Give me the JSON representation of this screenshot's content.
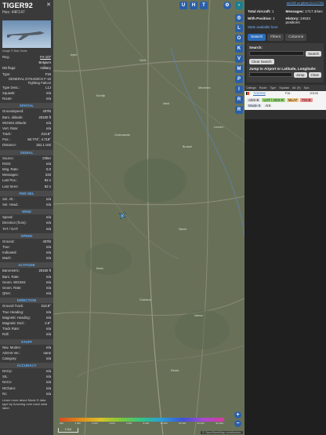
{
  "left": {
    "callsign": "TIGER92",
    "hex": "Hex: 44F147",
    "close": "✕",
    "image_caption": "Image © Bdw Smits",
    "basic": [
      {
        "k": "Reg.:",
        "v": "FA-107",
        "link": true
      },
      {
        "k": "",
        "v": "Belgium"
      },
      {
        "k": "DB flags:",
        "v": "military"
      },
      {
        "k": "Type:",
        "v": "F16"
      },
      {
        "k": "GENERAL DYNAMICS F-16 Fighting Falcon",
        "v": ""
      },
      {
        "k": "Type Desc.:",
        "v": "L1J"
      },
      {
        "k": "Squawk:",
        "v": "n/a"
      },
      {
        "k": "Route:",
        "v": "n/a"
      }
    ],
    "sections": [
      {
        "title": "SPATIAL",
        "rows": [
          {
            "k": "Groundspeed:",
            "v": "437kt"
          },
          {
            "k": "Baro. altitude:",
            "v": "20100 ft"
          },
          {
            "k": "WGS84 altitude:",
            "v": "n/a"
          },
          {
            "k": "Vert. Rate:",
            "v": "n/a"
          },
          {
            "k": "Track:",
            "v": "213.8°"
          },
          {
            "k": "Pos.:",
            "v": "50.774°, 4.718°"
          },
          {
            "k": "Distance:",
            "v": "151.1 nmi"
          }
        ]
      },
      {
        "title": "SIGNAL",
        "rows": [
          {
            "k": "Source:",
            "v": "Other"
          },
          {
            "k": "RSSI:",
            "v": "n/a"
          },
          {
            "k": "Msg. Rate:",
            "v": "0.0"
          },
          {
            "k": "Messages:",
            "v": "233"
          },
          {
            "k": "Last Pos.:",
            "v": "92 s"
          },
          {
            "k": "Last Seen:",
            "v": "62 s"
          }
        ]
      },
      {
        "title": "FMS SEL",
        "rows": [
          {
            "k": "Sel. Alt.:",
            "v": "n/a"
          },
          {
            "k": "Sel. Head.:",
            "v": "n/a"
          }
        ]
      },
      {
        "title": "WIND",
        "rows": [
          {
            "k": "Speed:",
            "v": "n/a"
          },
          {
            "k": "Direction (from):",
            "v": "n/a"
          },
          {
            "k": "TAT / OAT:",
            "v": "n/a"
          }
        ]
      },
      {
        "title": "SPEED",
        "rows": [
          {
            "k": "Ground:",
            "v": "437kt"
          },
          {
            "k": "True:",
            "v": "n/a"
          },
          {
            "k": "Indicated:",
            "v": "n/a"
          },
          {
            "k": "Mach:",
            "v": "n/a"
          }
        ]
      },
      {
        "title": "ALTITUDE",
        "rows": [
          {
            "k": "Barometric:",
            "v": "20100 ft"
          },
          {
            "k": "Baro. Rate:",
            "v": "n/a"
          },
          {
            "k": "Geom. WGS84:",
            "v": "n/a"
          },
          {
            "k": "Geom. Rate:",
            "v": "n/a"
          },
          {
            "k": "QNH:",
            "v": "n/a"
          }
        ]
      },
      {
        "title": "DIRECTION",
        "rows": [
          {
            "k": "Ground Track:",
            "v": "213.8°"
          },
          {
            "k": "True Heading:",
            "v": "n/a"
          },
          {
            "k": "Magnetic Heading:",
            "v": "n/a"
          },
          {
            "k": "Magnetic Decl.:",
            "v": "2.6°"
          },
          {
            "k": "Track Rate:",
            "v": "n/a"
          },
          {
            "k": "Roll:",
            "v": "n/a"
          }
        ]
      },
      {
        "title": "STUFF",
        "rows": [
          {
            "k": "Nav. Modes:",
            "v": "n/a"
          },
          {
            "k": "ADS-B Ver.:",
            "v": "none"
          },
          {
            "k": "Category:",
            "v": "n/a"
          }
        ]
      },
      {
        "title": "ACCURACY",
        "rows": [
          {
            "k": "NACp:",
            "v": "n/a"
          },
          {
            "k": "SIL:",
            "v": "n/a"
          },
          {
            "k": "NACv:",
            "v": "n/a"
          },
          {
            "k": "NICbaro:",
            "v": "n/a"
          },
          {
            "k": "Rc:",
            "v": "n/a"
          }
        ]
      }
    ],
    "footer": "Learn more about Mode S data type by hovering over each data label."
  },
  "map": {
    "buttons_top": [
      "U",
      "H",
      "T"
    ],
    "side_buttons": [
      "",
      "L",
      "O",
      "K",
      "V",
      "M",
      "P",
      "I",
      "R",
      "R"
    ],
    "places": [
      "Ieper",
      "Kortrijk",
      "Gent",
      "Oudenaarde",
      "Aalst",
      "Brussel",
      "Leuven",
      "Mechelen",
      "Wavre",
      "Namur",
      "Charleroi",
      "Mons",
      "Dinant"
    ],
    "legend_ticks": [
      "500",
      "1 000",
      "2 000",
      "4 000",
      "6 000",
      "8 000",
      "10 000",
      "20 000",
      "30 000",
      "40 000+"
    ],
    "scale": "5 NM",
    "attribution": "© OpenStreetMap contributors.",
    "zoom_in": "+",
    "zoom_out": "−"
  },
  "right": {
    "top_link": "tar1090 on github (3.14.1759)",
    "stats": [
      {
        "label": "Total Aircraft:",
        "value": "1"
      },
      {
        "label": "Messages:",
        "value": "1717.3/sec"
      },
      {
        "label": "With Position:",
        "value": "1"
      },
      {
        "label": "History:",
        "value": "24533 positions"
      }
    ],
    "stats_link": "Stats available here",
    "tabs": [
      "Search",
      "Filters",
      "Columns"
    ],
    "search_label": "Search:",
    "search_button": "Search",
    "clear_search": "Clear Search",
    "jump_label": "Jump to Airport or Latitude, Longitude:",
    "jump_button": "Jump",
    "clear_button": "Clear",
    "columns": [
      "Callsign",
      "Route",
      "Type",
      "Squawk",
      "Alt. (ft)",
      "Spd."
    ],
    "row": {
      "callsign": "TIGER92",
      "type": "F16",
      "alt": "20100"
    },
    "badges": [
      "ADS-B",
      "UAT / ADS-R",
      "MLAT",
      "TIS-B",
      "Mode-S",
      "AIS"
    ]
  }
}
